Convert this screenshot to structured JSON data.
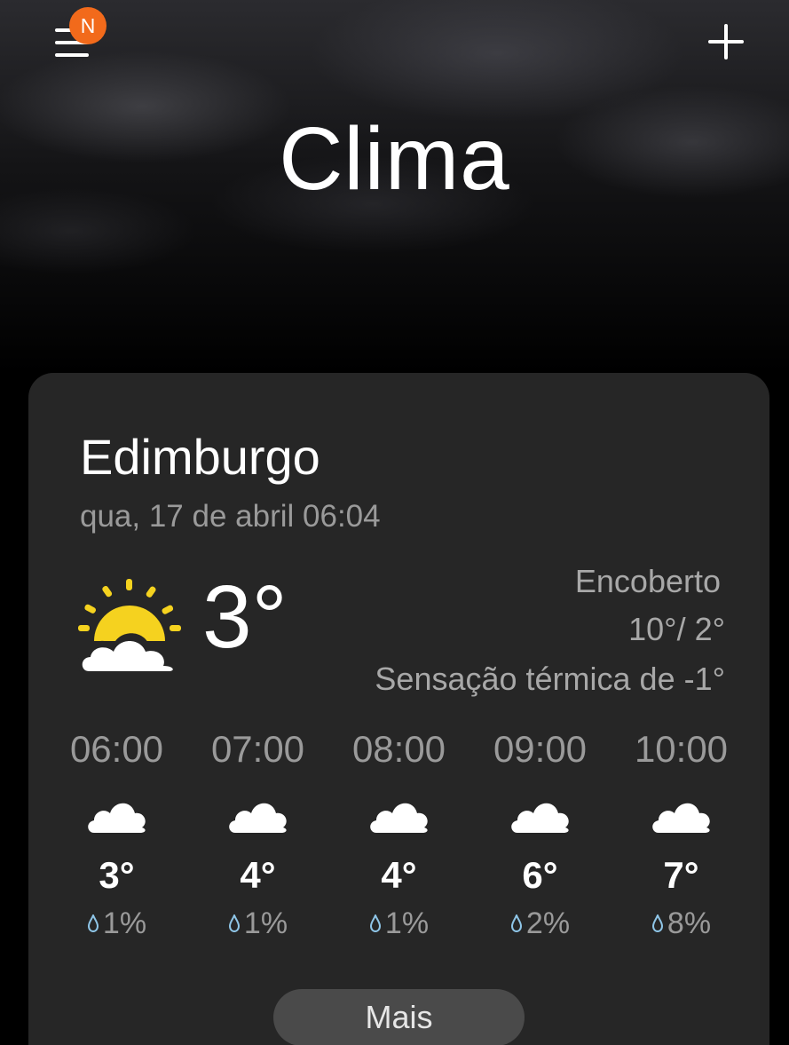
{
  "header": {
    "title": "Clima",
    "menu_badge": "N"
  },
  "location": {
    "city": "Edimburgo",
    "datetime": "qua, 17 de abril 06:04"
  },
  "current": {
    "temperature": "3°",
    "icon": "partly-sunny-icon",
    "condition": "Encoberto",
    "high_low": "10°/ 2°",
    "feels_like": "Sensação térmica de -1°"
  },
  "hourly": [
    {
      "time": "06:00",
      "icon": "cloud-icon",
      "temp": "3°",
      "precip": "1%"
    },
    {
      "time": "07:00",
      "icon": "cloud-icon",
      "temp": "4°",
      "precip": "1%"
    },
    {
      "time": "08:00",
      "icon": "cloud-icon",
      "temp": "4°",
      "precip": "1%"
    },
    {
      "time": "09:00",
      "icon": "cloud-icon",
      "temp": "6°",
      "precip": "2%"
    },
    {
      "time": "10:00",
      "icon": "cloud-icon",
      "temp": "7°",
      "precip": "8%"
    }
  ],
  "actions": {
    "more_label": "Mais"
  },
  "colors": {
    "badge": "#f26a1b",
    "sun": "#f5d21f",
    "card": "#262626",
    "drop": "#8fc6e8"
  }
}
